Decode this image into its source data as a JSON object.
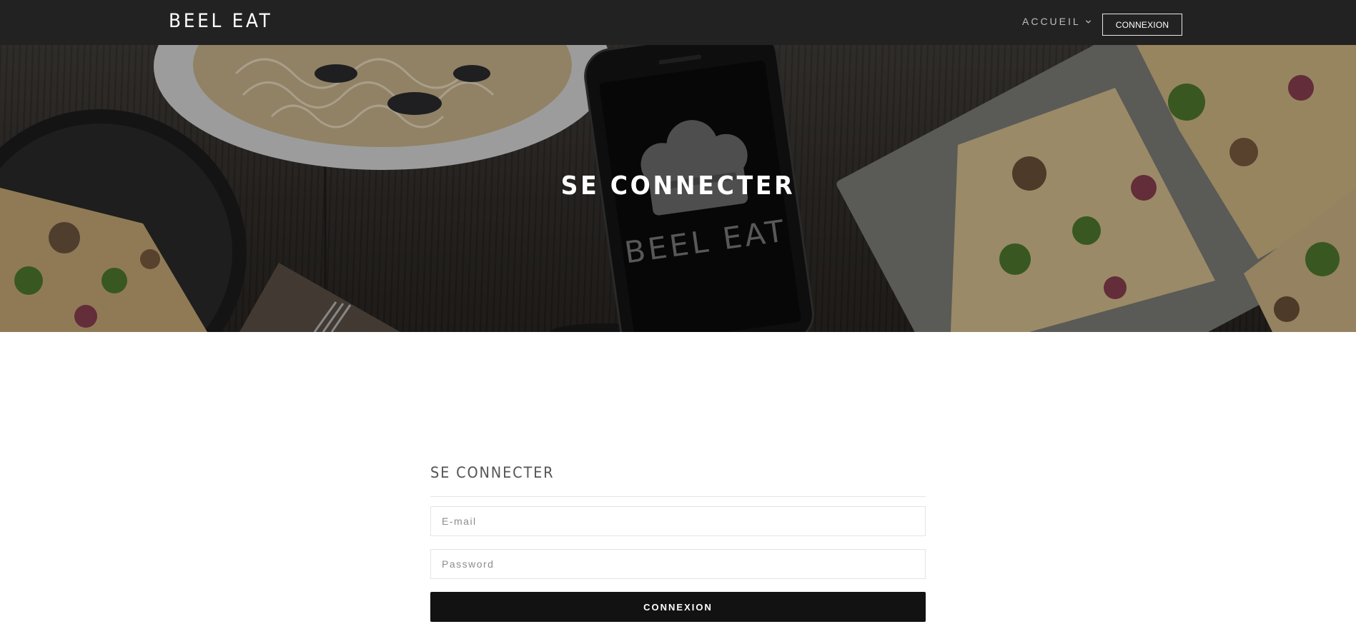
{
  "navbar": {
    "brand": "BEEL EAT",
    "menu_label": "ACCUEIL",
    "menu_icon": "chevron-down-icon",
    "login_button": "CONNEXION"
  },
  "hero": {
    "title": "SE CONNECTER",
    "phone_logo_text": "BEEL EAT"
  },
  "login": {
    "title": "SE CONNECTER",
    "email": {
      "placeholder": "E-mail",
      "value": ""
    },
    "password": {
      "placeholder": "Password",
      "value": ""
    },
    "submit_label": "CONNEXION"
  },
  "colors": {
    "navbar_bg": "#222222",
    "button_bg": "#121212",
    "text_light": "#ffffff",
    "title_gray": "#555555"
  }
}
